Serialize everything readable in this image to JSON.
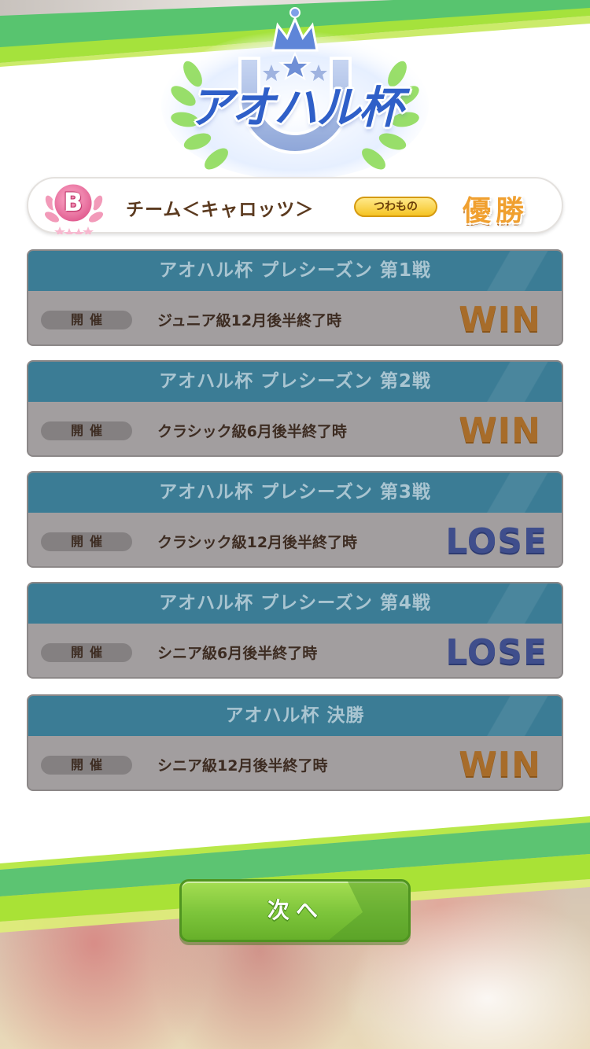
{
  "logo": {
    "title": "アオハル杯",
    "icon": "crown-horseshoe-laurel-emblem"
  },
  "team": {
    "rank": "B",
    "name": "チーム＜キャロッツ＞",
    "difficulty": "つわもの",
    "result": "優勝"
  },
  "races": [
    {
      "title": "アオハル杯 プレシーズン 第1戦",
      "held_label": "開催",
      "timing": "ジュニア級12月後半終了時",
      "outcome": "WIN"
    },
    {
      "title": "アオハル杯 プレシーズン 第2戦",
      "held_label": "開催",
      "timing": "クラシック級6月後半終了時",
      "outcome": "WIN"
    },
    {
      "title": "アオハル杯 プレシーズン 第3戦",
      "held_label": "開催",
      "timing": "クラシック級12月後半終了時",
      "outcome": "LOSE"
    },
    {
      "title": "アオハル杯 プレシーズン 第4戦",
      "held_label": "開催",
      "timing": "シニア級6月後半終了時",
      "outcome": "LOSE"
    },
    {
      "title": "アオハル杯 決勝",
      "held_label": "開催",
      "timing": "シニア級12月後半終了時",
      "outcome": "WIN"
    }
  ],
  "next_button": {
    "label": "次へ"
  },
  "colors": {
    "header_teal": "#3b7c95",
    "card_gray": "#a29e9f",
    "win": "#a76c2a",
    "lose": "#3f4e8c",
    "button_green": "#7cc43a",
    "stripe_green": "#58c46f",
    "stripe_lime": "#a5e23c"
  }
}
